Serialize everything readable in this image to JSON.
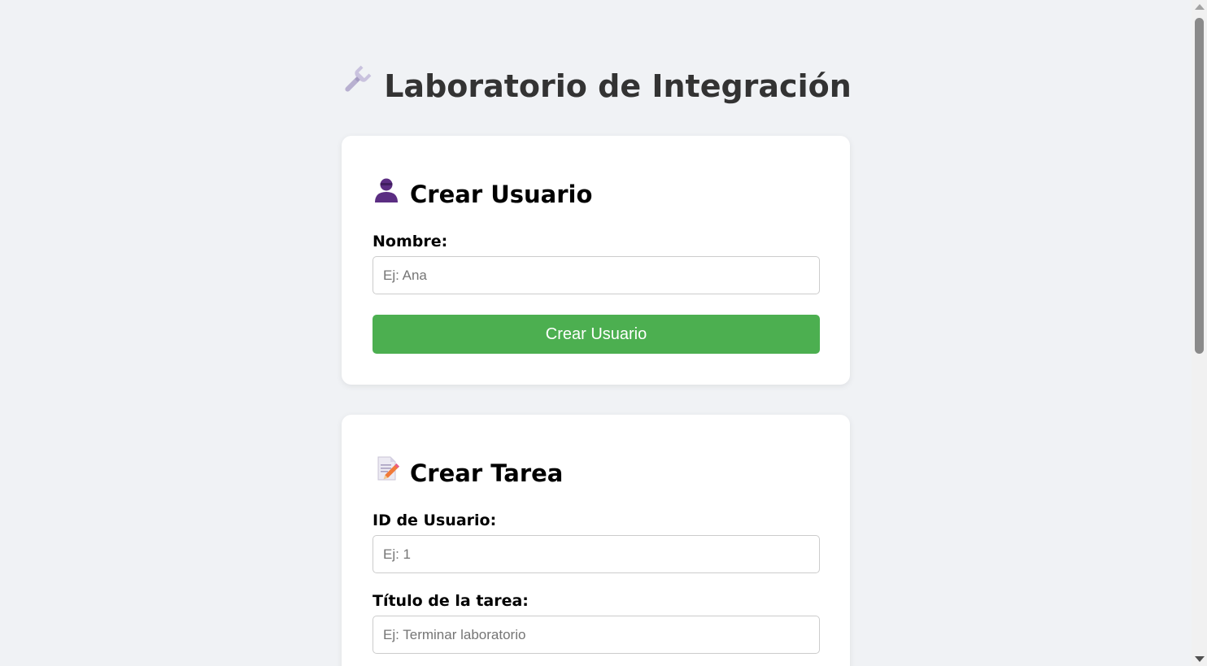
{
  "header": {
    "icon": "wrench-icon",
    "title": "Laboratorio de Integración"
  },
  "create_user": {
    "icon": "user-bust-icon",
    "title": "Crear Usuario",
    "name_label": "Nombre:",
    "name_placeholder": "Ej: Ana",
    "name_value": "",
    "submit_label": "Crear Usuario"
  },
  "create_task": {
    "icon": "memo-pencil-icon",
    "title": "Crear Tarea",
    "user_id_label": "ID de Usuario:",
    "user_id_placeholder": "Ej: 1",
    "user_id_value": "",
    "task_title_label": "Título de la tarea:",
    "task_title_placeholder": "Ej: Terminar laboratorio",
    "task_title_value": ""
  },
  "colors": {
    "page_background": "#f0f2f5",
    "card_background": "#ffffff",
    "primary_button": "#4caf50",
    "title_text": "#333333",
    "user_icon": "#5b2d82"
  }
}
